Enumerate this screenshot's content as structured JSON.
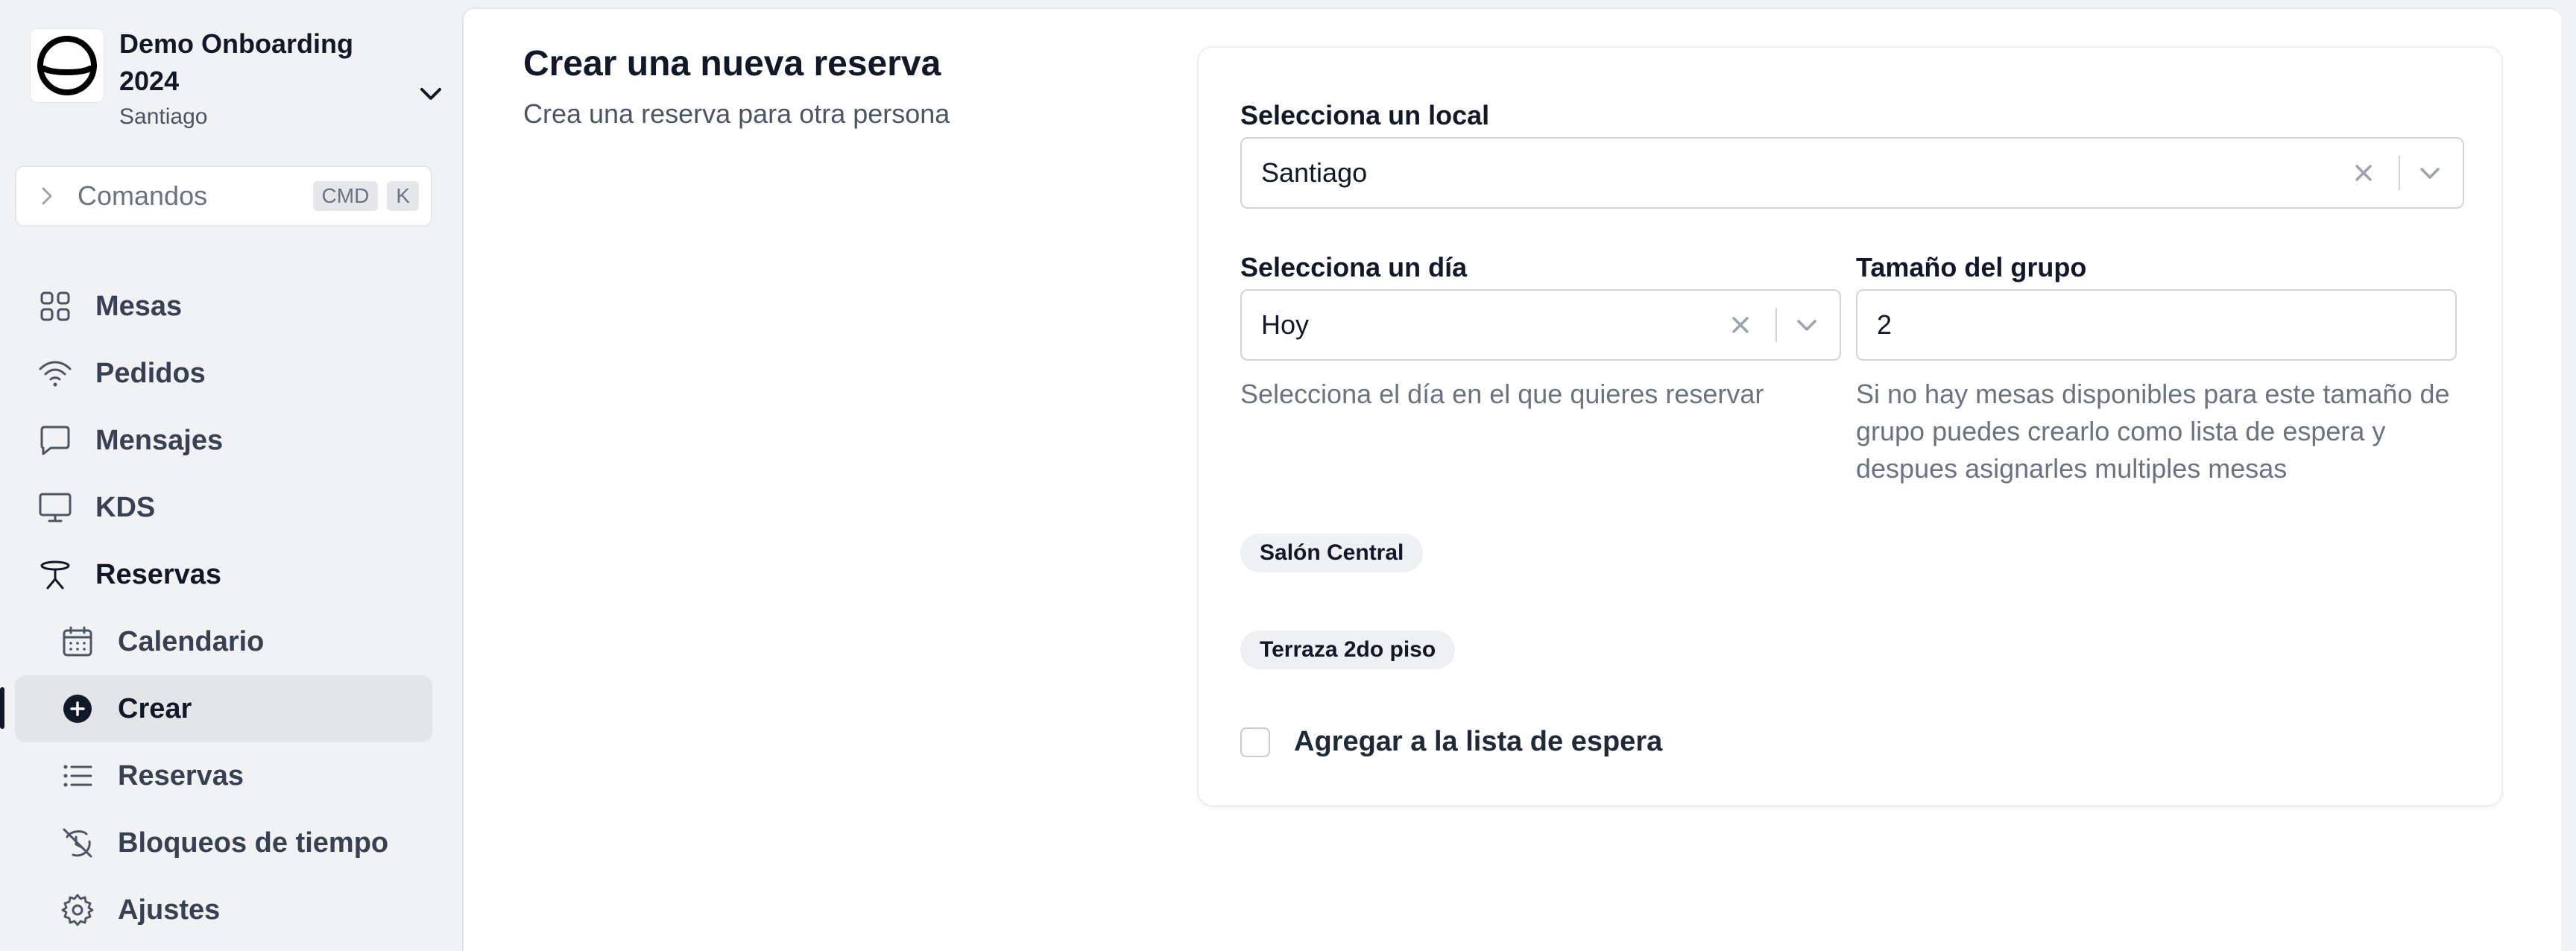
{
  "org": {
    "name": "Demo Onboarding 2024",
    "location": "Santiago"
  },
  "command": {
    "label": "Comandos",
    "shortcut_keys": [
      "CMD",
      "K"
    ]
  },
  "nav": {
    "items": [
      {
        "label": "Mesas",
        "icon": "grid-icon"
      },
      {
        "label": "Pedidos",
        "icon": "wifi-icon"
      },
      {
        "label": "Mensajes",
        "icon": "message-icon"
      },
      {
        "label": "KDS",
        "icon": "monitor-icon"
      },
      {
        "label": "Reservas",
        "icon": "table-reservation-icon"
      }
    ],
    "reservas_sub": [
      {
        "label": "Calendario",
        "icon": "calendar-icon"
      },
      {
        "label": "Crear",
        "icon": "plus-circle-icon",
        "active": true
      },
      {
        "label": "Reservas",
        "icon": "list-icon"
      },
      {
        "label": "Bloqueos de tiempo",
        "icon": "slash-clock-icon"
      },
      {
        "label": "Ajustes",
        "icon": "gear-icon"
      }
    ]
  },
  "page": {
    "title": "Crear una nueva reserva",
    "subtitle": "Crea una reserva para otra persona"
  },
  "form": {
    "local": {
      "label": "Selecciona un local",
      "value": "Santiago"
    },
    "dia": {
      "label": "Selecciona un día",
      "value": "Hoy",
      "help": "Selecciona el día en el que quieres reservar"
    },
    "grupo": {
      "label": "Tamaño del grupo",
      "value": "2",
      "help": "Si no hay mesas disponibles para este tamaño de grupo puedes crearlo como lista de espera y despues asignarles multiples mesas"
    },
    "zones": [
      "Salón Central",
      "Terraza 2do piso"
    ],
    "waitlist_label": "Agregar a la lista de espera"
  },
  "colors": {
    "background": "#f1f2f4",
    "panel": "#ffffff",
    "active_item": "#e4e5e8",
    "text": "#111827",
    "muted": "#6b7280"
  }
}
